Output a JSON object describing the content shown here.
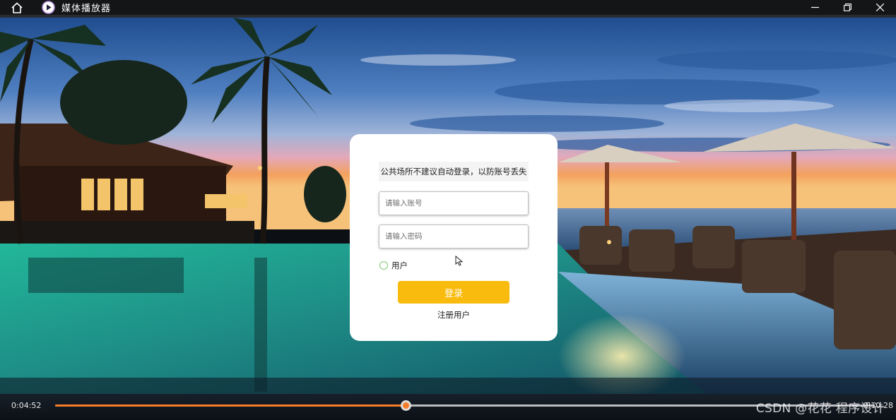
{
  "window": {
    "title": "媒体播放器",
    "home_icon": "home-icon",
    "app_icon": "play-circle-icon",
    "controls": [
      "minimize-icon",
      "restore-icon",
      "close-icon"
    ]
  },
  "login": {
    "notice": "公共场所不建议自动登录，以防账号丢失",
    "account_placeholder": "请输入账号",
    "password_placeholder": "请输入密码",
    "role_option": "用户",
    "login_button": "登录",
    "register_link": "注册用户",
    "accent_color": "#f9bb0d"
  },
  "player": {
    "current_time": "0:04:52",
    "total_time": "0:10:28",
    "progress_fraction": 0.428,
    "progress_color": "#f57d2a"
  },
  "watermark": "CSDN @花花 程序设计"
}
